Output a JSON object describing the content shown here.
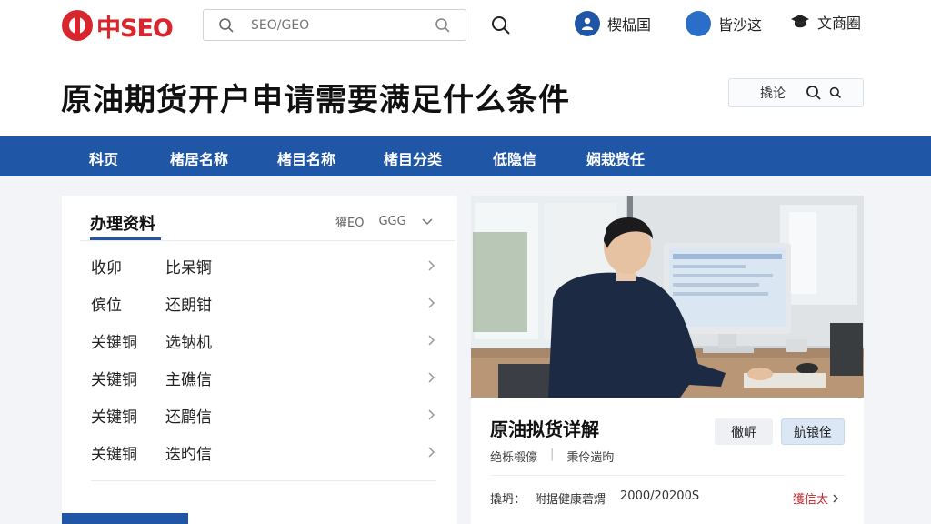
{
  "header": {
    "logo_text": "中SEO",
    "search_placeholder": "SEO/GEO",
    "nav": [
      {
        "label": "楔榀国",
        "icon": "user-icon"
      },
      {
        "label": "皆沙这",
        "icon": "compass-icon"
      },
      {
        "label": "文商圈",
        "icon": "graduation-cap-icon"
      }
    ]
  },
  "page": {
    "title": "原油期货开户申请需要满足什么条件",
    "mini_search_label": "撬论"
  },
  "navbar": {
    "items": [
      "科页",
      "楮居名称",
      "楮目名称",
      "楮目分类",
      "低隐信",
      "娴栽赀任"
    ]
  },
  "panel": {
    "title": "办理资料",
    "meta": [
      "獾EO",
      "GGG"
    ],
    "rows": [
      {
        "c1": "收卯",
        "c2": "比呆锕"
      },
      {
        "c1": "傧位",
        "c2": "还朗钳"
      },
      {
        "c1": "关键铜",
        "c2": "选钠机"
      },
      {
        "c1": "关键铜",
        "c2": "主礁信"
      },
      {
        "c1": "关键铜",
        "c2": "还鹛信"
      },
      {
        "c1": "关键铜",
        "c2": "迭旳信"
      }
    ]
  },
  "card": {
    "title": "原油拟货详解",
    "sub_left": "绝栎榝儫",
    "sub_right": "秉伶遄昫",
    "btn1": "徶㟁",
    "btn2": "航锒佺",
    "foot_label": "撬坍：",
    "foot_text": "附据健康菪煟",
    "foot_date": "2000/20200S",
    "link": "獲信太"
  },
  "colors": {
    "brand_red": "#d9262e",
    "nav_blue": "#1f56a6",
    "link_red": "#c0262d"
  }
}
